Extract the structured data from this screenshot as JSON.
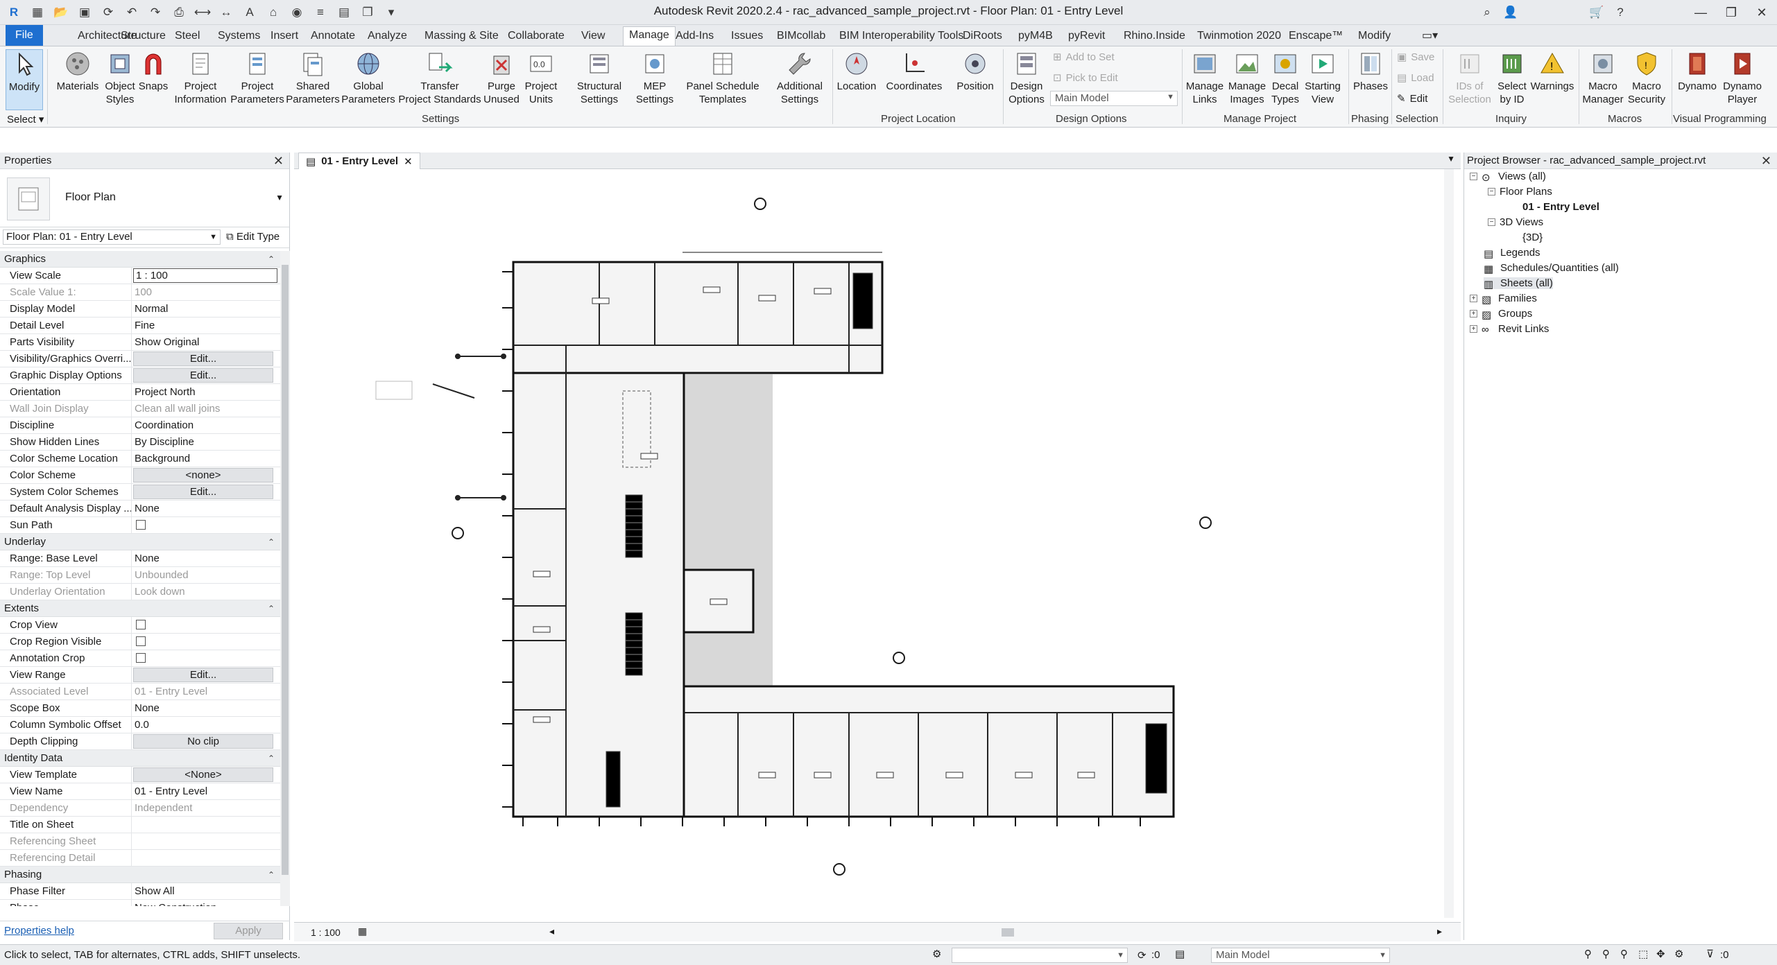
{
  "window": {
    "title": "Autodesk Revit 2020.2.4 - rac_advanced_sample_project.rvt - Floor Plan: 01 - Entry Level"
  },
  "menu_tabs": [
    "File",
    "Architecture",
    "Structure",
    "Steel",
    "Systems",
    "Insert",
    "Annotate",
    "Analyze",
    "Massing & Site",
    "Collaborate",
    "View",
    "Manage",
    "Add-Ins",
    "Issues",
    "BIMcollab",
    "BIM Interoperability Tools",
    "DiRoots",
    "pyM4B",
    "pyRevit",
    "Rhino.Inside",
    "Twinmotion 2020",
    "Enscape™",
    "Modify"
  ],
  "ribbon": {
    "modify": "Modify",
    "select": "Select",
    "settings": {
      "label": "Settings",
      "materials": "Materials",
      "object_styles": "Object\nStyles",
      "snaps": "Snaps",
      "project_information": "Project\nInformation",
      "project_parameters": "Project\nParameters",
      "shared_parameters": "Shared\nParameters",
      "global_parameters": "Global\nParameters",
      "transfer_project_standards": "Transfer\nProject Standards",
      "purge_unused": "Purge\nUnused",
      "project_units": "Project\nUnits",
      "structural_settings": "Structural\nSettings",
      "mep_settings": "MEP\nSettings",
      "panel_schedule_templates": "Panel Schedule\nTemplates",
      "additional_settings": "Additional\nSettings"
    },
    "project_location": {
      "label": "Project Location",
      "location": "Location",
      "coordinates": "Coordinates",
      "position": "Position"
    },
    "design_options": {
      "label": "Design Options",
      "design_options": "Design\nOptions",
      "add_to_set": "Add to Set",
      "pick_to_edit": "Pick to Edit",
      "main_model": "Main Model"
    },
    "manage_project": {
      "label": "Manage Project",
      "manage_links": "Manage\nLinks",
      "manage_images": "Manage\nImages",
      "decal_types": "Decal\nTypes",
      "starting_view": "Starting\nView"
    },
    "phasing": {
      "label": "Phasing",
      "phases": "Phases"
    },
    "selection": {
      "label": "Selection",
      "save": "Save",
      "load": "Load",
      "edit": "Edit"
    },
    "inquiry": {
      "label": "Inquiry",
      "ids_of_selection": "IDs of\nSelection",
      "select_by_id": "Select\nby ID",
      "warnings": "Warnings"
    },
    "macros": {
      "label": "Macros",
      "macro_manager": "Macro\nManager",
      "macro_security": "Macro\nSecurity"
    },
    "visual_programming": {
      "label": "Visual Programming",
      "dynamo": "Dynamo",
      "dynamo_player": "Dynamo\nPlayer"
    }
  },
  "properties": {
    "title": "Properties",
    "type_name": "Floor Plan",
    "instance_selector": "Floor Plan: 01 - Entry Level",
    "edit_type": "Edit Type",
    "groups": [
      {
        "name": "Graphics",
        "rows": [
          {
            "k": "View Scale",
            "v": "1 : 100",
            "style": "boxed"
          },
          {
            "k": "Scale Value    1:",
            "v": "100",
            "style": "ro"
          },
          {
            "k": "Display Model",
            "v": "Normal"
          },
          {
            "k": "Detail Level",
            "v": "Fine"
          },
          {
            "k": "Parts Visibility",
            "v": "Show Original"
          },
          {
            "k": "Visibility/Graphics Overri...",
            "v": "Edit...",
            "style": "btn"
          },
          {
            "k": "Graphic Display Options",
            "v": "Edit...",
            "style": "btn"
          },
          {
            "k": "Orientation",
            "v": "Project North"
          },
          {
            "k": "Wall Join Display",
            "v": "Clean all wall joins",
            "style": "ro"
          },
          {
            "k": "Discipline",
            "v": "Coordination"
          },
          {
            "k": "Show Hidden Lines",
            "v": "By Discipline"
          },
          {
            "k": "Color Scheme Location",
            "v": "Background"
          },
          {
            "k": "Color Scheme",
            "v": "<none>",
            "style": "btn"
          },
          {
            "k": "System Color Schemes",
            "v": "Edit...",
            "style": "btn"
          },
          {
            "k": "Default Analysis Display ...",
            "v": "None"
          },
          {
            "k": "Sun Path",
            "v": "",
            "style": "chk"
          }
        ]
      },
      {
        "name": "Underlay",
        "rows": [
          {
            "k": "Range: Base Level",
            "v": "None"
          },
          {
            "k": "Range: Top Level",
            "v": "Unbounded",
            "style": "ro"
          },
          {
            "k": "Underlay Orientation",
            "v": "Look down",
            "style": "ro"
          }
        ]
      },
      {
        "name": "Extents",
        "rows": [
          {
            "k": "Crop View",
            "v": "",
            "style": "chk"
          },
          {
            "k": "Crop Region Visible",
            "v": "",
            "style": "chk"
          },
          {
            "k": "Annotation Crop",
            "v": "",
            "style": "chk"
          },
          {
            "k": "View Range",
            "v": "Edit...",
            "style": "btn"
          },
          {
            "k": "Associated Level",
            "v": "01 - Entry Level",
            "style": "ro"
          },
          {
            "k": "Scope Box",
            "v": "None"
          },
          {
            "k": "Column Symbolic Offset",
            "v": "0.0"
          },
          {
            "k": "Depth Clipping",
            "v": "No clip",
            "style": "btn"
          }
        ]
      },
      {
        "name": "Identity Data",
        "rows": [
          {
            "k": "View Template",
            "v": "<None>",
            "style": "btn"
          },
          {
            "k": "View Name",
            "v": "01 - Entry Level"
          },
          {
            "k": "Dependency",
            "v": "Independent",
            "style": "ro"
          },
          {
            "k": "Title on Sheet",
            "v": ""
          },
          {
            "k": "Referencing Sheet",
            "v": "",
            "style": "ro"
          },
          {
            "k": "Referencing Detail",
            "v": "",
            "style": "ro"
          }
        ]
      },
      {
        "name": "Phasing",
        "rows": [
          {
            "k": "Phase Filter",
            "v": "Show All"
          },
          {
            "k": "Phase",
            "v": "New Construction"
          }
        ]
      }
    ],
    "help_link": "Properties help",
    "apply": "Apply"
  },
  "view": {
    "tab_label": "01 - Entry Level",
    "scale": "1 : 100"
  },
  "browser": {
    "title": "Project Browser - rac_advanced_sample_project.rvt",
    "nodes": {
      "views": "Views (all)",
      "floor_plans": "Floor Plans",
      "entry_level": "01 - Entry Level",
      "views_3d": "3D Views",
      "view_3d": "{3D}",
      "legends": "Legends",
      "schedules": "Schedules/Quantities (all)",
      "sheets": "Sheets (all)",
      "families": "Families",
      "groups": "Groups",
      "revit_links": "Revit Links"
    }
  },
  "status": {
    "message": "Click to select, TAB for alternates, CTRL adds, SHIFT unselects.",
    "count": ":0",
    "model": "Main Model",
    "filter_count": ":0"
  }
}
